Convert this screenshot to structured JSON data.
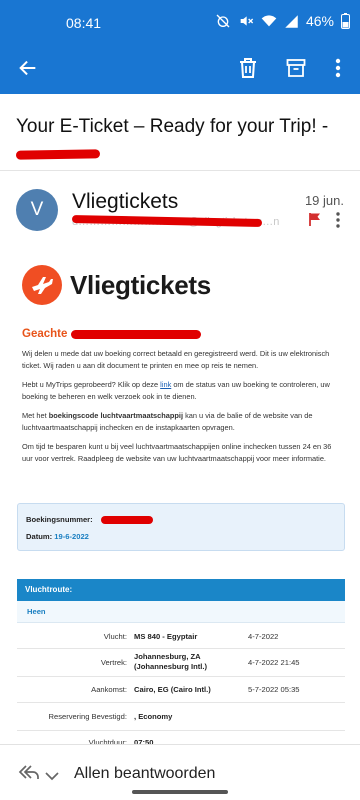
{
  "status_bar": {
    "time": "08:41",
    "battery": "46%"
  },
  "app_bar": {
    "back_icon": "arrow-left-icon",
    "actions": [
      "delete-icon",
      "archive-icon",
      "more-vert-icon"
    ]
  },
  "subject": {
    "text": "Your E-Ticket – Ready for your Trip! -"
  },
  "sender": {
    "initial": "V",
    "name": "Vliegtickets",
    "email_fragment": "d…………………………@vliegtickets.n…n",
    "date": "19 jun."
  },
  "email": {
    "logo_text": "Vliegtickets",
    "greeting": "Geachte",
    "paragraphs": {
      "p1": "Wij delen u mede dat uw boeking correct betaald en geregistreerd werd. Dit is uw elektronisch ticket. Wij raden u aan dit document te printen en mee op reis te nemen.",
      "p2_before": "Hebt u MyTrips geprobeerd? Klik op deze ",
      "p2_link": "link",
      "p2_after": " om de status van uw boeking te controleren, uw boeking te beheren en welk verzoek ook in te dienen.",
      "p3_before": "Met het ",
      "p3_bold": "boekingscode luchtvaartmaatschappij",
      "p3_after": " kan u via de balie of de website van de luchtvaartmaatschappij inchecken en de instapkaarten opvragen.",
      "p4": "Om tijd te besparen kunt u bij veel luchtvaartmaatschappijen online inchecken tussen 24 en 36 uur voor vertrek. Raadpleeg de website van uw luchtvaartmaatschappij voor meer informatie."
    },
    "booking": {
      "number_label": "Boekingsnummer:",
      "date_label": "Datum:",
      "date_value": "19-6-2022"
    },
    "flight": {
      "header": "Vluchtroute:",
      "tab": "Heen",
      "rows": [
        {
          "label": "Vlucht:",
          "value": "MS 840 - Egyptair",
          "time": "4-7-2022"
        },
        {
          "label": "Vertrek:",
          "value": "Johannesburg, ZA (Johannesburg Intl.)",
          "time": "4-7-2022 21:45"
        },
        {
          "label": "Aankomst:",
          "value": "Cairo, EG (Cairo Intl.)",
          "time": "5-7-2022 05:35"
        },
        {
          "label": "Reservering Bevestigd:",
          "value": ", Economy",
          "time": ""
        },
        {
          "label": "Vluchtduur:",
          "value": "07:50",
          "time": ""
        }
      ]
    }
  },
  "reply_bar": {
    "label": "Allen beantwoorden"
  },
  "colors": {
    "primary": "#1976d2",
    "brand_orange": "#f04e23",
    "link_blue": "#1a7fc1",
    "redaction": "#e00000"
  }
}
